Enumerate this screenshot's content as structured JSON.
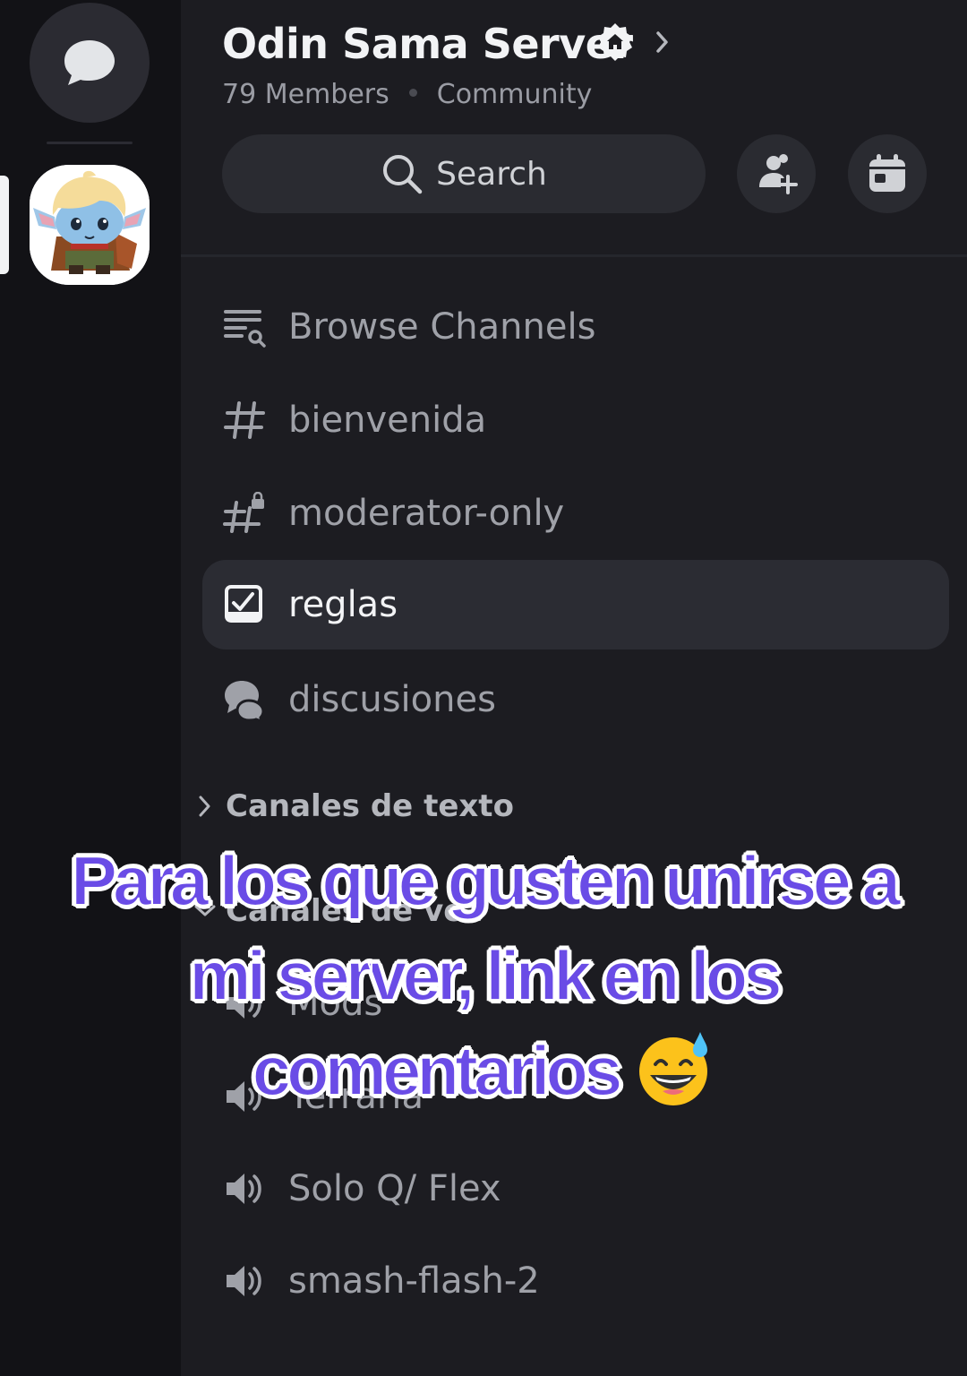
{
  "server": {
    "name": "Odin Sama Server",
    "members": "79 Members",
    "type": "Community"
  },
  "search": {
    "label": "Search"
  },
  "channels": [
    {
      "label": "Browse Channels",
      "icon": "browse-channels-icon"
    },
    {
      "label": "bienvenida",
      "icon": "hash-icon"
    },
    {
      "label": "moderator-only",
      "icon": "locked-hash-icon"
    },
    {
      "label": "reglas",
      "icon": "rules-icon",
      "active": true
    },
    {
      "label": "discusiones",
      "icon": "forum-icon"
    }
  ],
  "categories": [
    {
      "label": "Canales de texto",
      "collapsed": true
    },
    {
      "label": "Canales de voz",
      "collapsed": false
    }
  ],
  "voice_channels": [
    {
      "label": "Mods"
    },
    {
      "label": "Terraria"
    },
    {
      "label": "Solo Q/ Flex"
    },
    {
      "label": "smash-flash-2"
    }
  ],
  "overlay": {
    "line1": "Para los que gusten unirse a",
    "line2": "mi server, link en los",
    "line3": "comentarios",
    "emoji_name": "grinning-face-with-sweat-emoji"
  },
  "colors": {
    "rail_bg": "#121216",
    "panel_bg": "#1c1c21",
    "active_channel_bg": "#2b2c33",
    "overlay_text": "#6a4ce6"
  }
}
